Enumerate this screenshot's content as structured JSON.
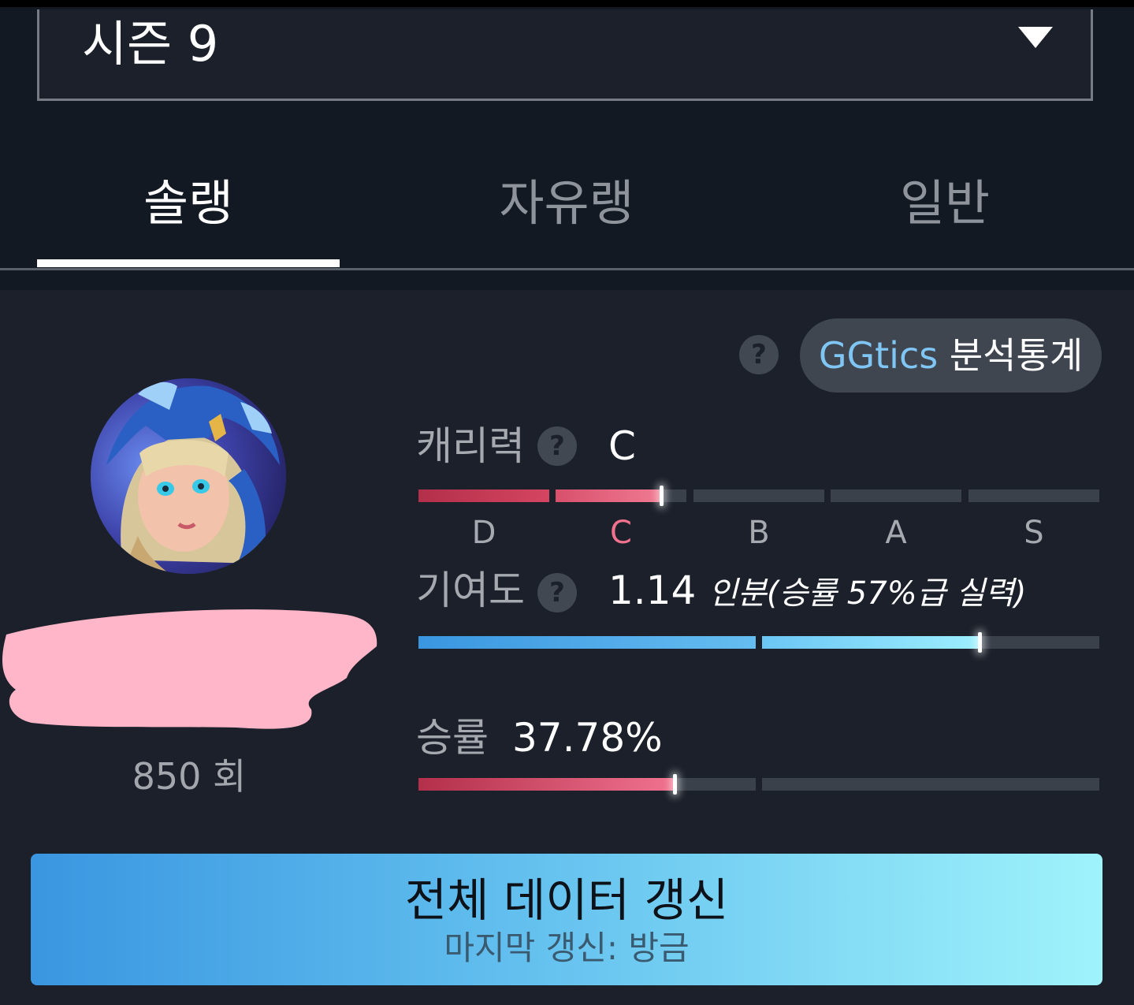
{
  "season_select": {
    "label": "시즌 9"
  },
  "tabs": [
    {
      "label": "솔랭",
      "active": true
    },
    {
      "label": "자유랭",
      "active": false
    },
    {
      "label": "일반",
      "active": false
    }
  ],
  "analysis": {
    "help_icon": "?",
    "brand": "GGtics",
    "label": "분석통계"
  },
  "profile": {
    "play_count": "850 회"
  },
  "carry": {
    "label": "캐리력",
    "help_icon": "?",
    "value": "C",
    "grades": [
      "D",
      "C",
      "B",
      "A",
      "S"
    ],
    "current_grade_index": 1,
    "progress": 0.3
  },
  "contribution": {
    "label": "기여도",
    "help_icon": "?",
    "value": "1.14",
    "detail": "인분(승률 57%급 실력)",
    "progress": 0.826
  },
  "winrate": {
    "label": "승률",
    "value": "37.78%",
    "progress": 0.3778
  },
  "refresh": {
    "title": "전체 데이터 갱신",
    "subtitle": "마지막 갱신: 방금"
  },
  "colors": {
    "accent_blue": "#3a96e0",
    "accent_cyan": "#9ff3fb",
    "grade_red": "#c43450",
    "grade_pink": "#f0728f",
    "brand_blue": "#7fc6f5"
  }
}
